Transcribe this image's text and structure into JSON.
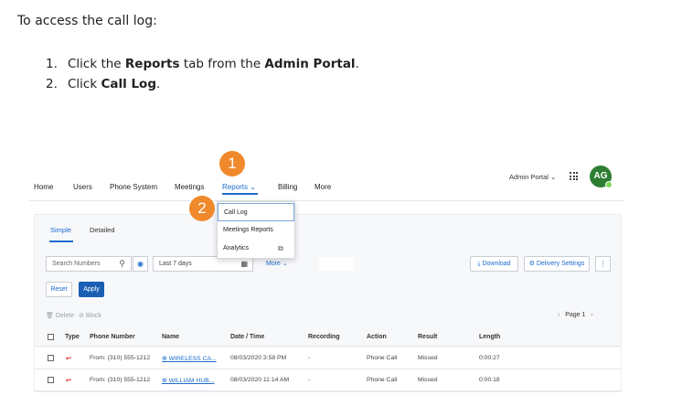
{
  "intro": "To access the call log:",
  "steps": [
    {
      "num": "1.",
      "pre": "Click the ",
      "bold1": "Reports",
      "mid": " tab from the ",
      "bold2": "Admin Portal",
      "post": "."
    },
    {
      "num": "2.",
      "pre": "Click ",
      "bold1": "Call Log",
      "post": "."
    }
  ],
  "nav": {
    "items": [
      "Home",
      "Users",
      "Phone System",
      "Meetings",
      "Reports ⌄",
      "Billing",
      "More"
    ],
    "admin_portal": "Admin Portal ⌄",
    "avatar": "AG"
  },
  "badges": [
    "1",
    "2"
  ],
  "dropdown": [
    "Call Log",
    "Meetings Reports",
    "Analytics"
  ],
  "tabs": [
    "Simple",
    "Detailed"
  ],
  "filters": {
    "search_placeholder": "Search Numbers",
    "date_range": "Last 7 days",
    "more": "More ⌄",
    "download": "⤓ Download",
    "delivery": "⚙ Delivery Settings",
    "reset": "Reset",
    "apply": "Apply"
  },
  "toolbar": {
    "delete": "Delete",
    "block": "Block",
    "page": "Page 1"
  },
  "columns": [
    "Type",
    "Phone Number",
    "Name",
    "Date / Time",
    "Recording",
    "Action",
    "Result",
    "Length"
  ],
  "rows": [
    {
      "phone": "From: (310) 555-1212",
      "name": "WIRELESS CA...",
      "datetime": "08/03/2020 3:58 PM",
      "recording": "-",
      "action": "Phone Call",
      "result": "Missed",
      "length": "0:00:27"
    },
    {
      "phone": "From: (310) 555-1212",
      "name": "WILLIAM HUB...",
      "datetime": "08/03/2020 11:14 AM",
      "recording": "-",
      "action": "Phone Call",
      "result": "Missed",
      "length": "0:00:18"
    }
  ]
}
